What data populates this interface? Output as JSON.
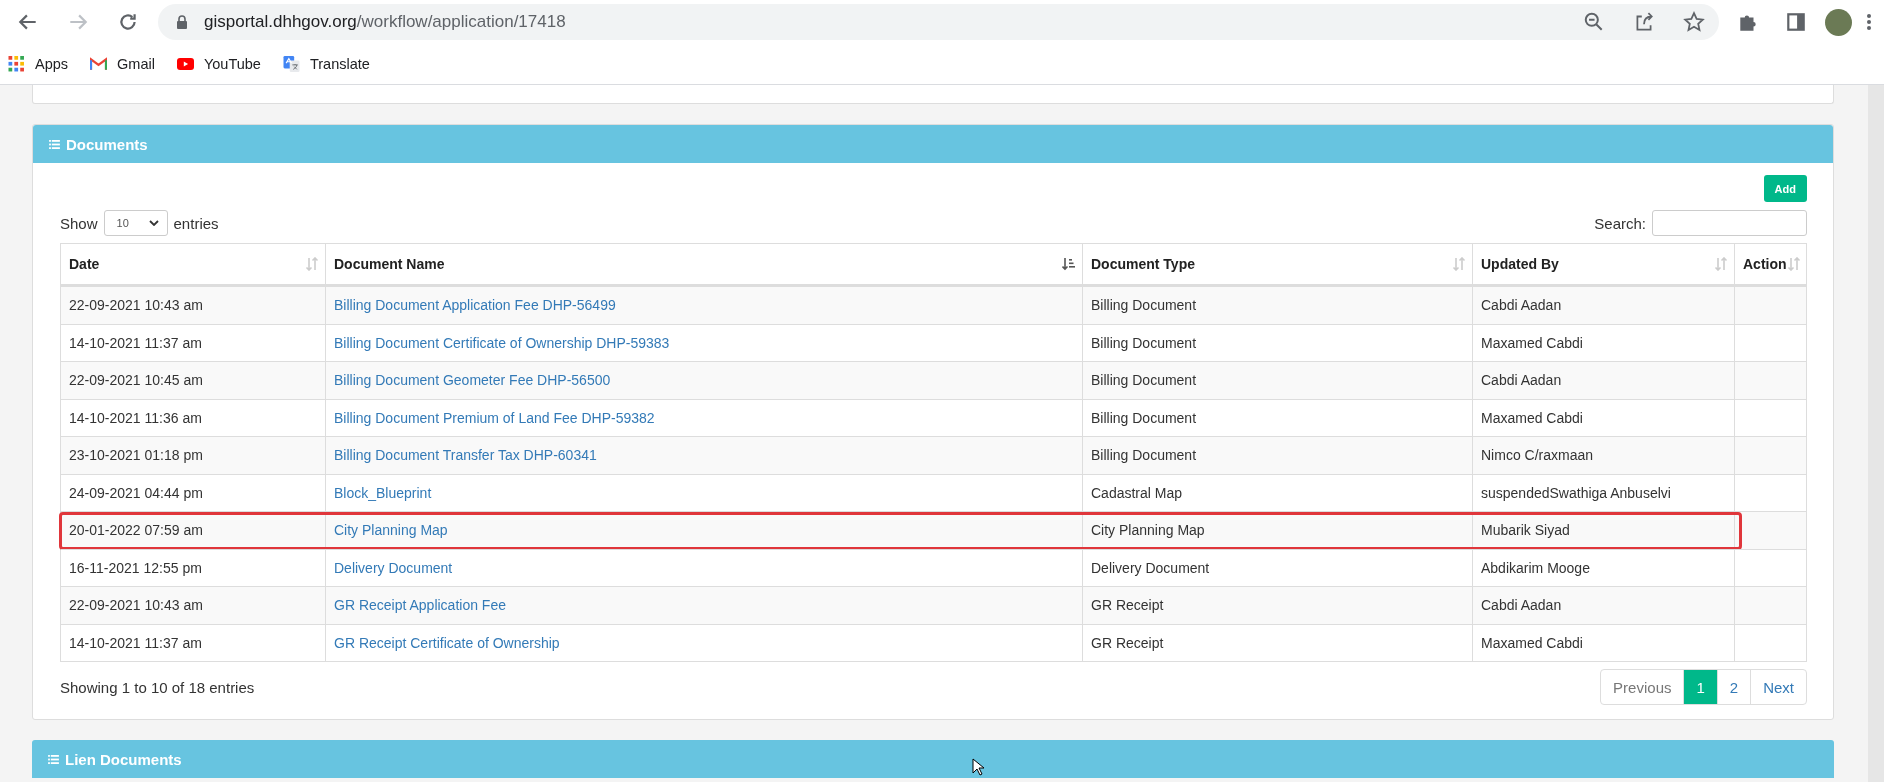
{
  "browser": {
    "url_domain": "gisportal.dhhgov.org",
    "url_path": "/workflow/application/17418",
    "bookmarks": [
      {
        "label": "Apps",
        "kind": "apps"
      },
      {
        "label": "Gmail",
        "kind": "gmail"
      },
      {
        "label": "YouTube",
        "kind": "youtube"
      },
      {
        "label": "Translate",
        "kind": "translate"
      }
    ]
  },
  "documents_panel": {
    "title": "Documents",
    "add_button": "Add",
    "show_label": "Show",
    "page_size": "10",
    "entries_label": "entries",
    "search_label": "Search:",
    "columns": [
      {
        "label": "Date",
        "sorted": false
      },
      {
        "label": "Document Name",
        "sorted": true
      },
      {
        "label": "Document Type",
        "sorted": false
      },
      {
        "label": "Updated By",
        "sorted": false
      },
      {
        "label": "Action",
        "sorted": false
      }
    ],
    "rows": [
      {
        "date": "22-09-2021 10:43 am",
        "name": "Billing Document Application Fee DHP-56499",
        "type": "Billing Document",
        "updated_by": "Cabdi Aadan",
        "highlighted": false
      },
      {
        "date": "14-10-2021 11:37 am",
        "name": "Billing Document Certificate of Ownership DHP-59383",
        "type": "Billing Document",
        "updated_by": "Maxamed Cabdi",
        "highlighted": false
      },
      {
        "date": "22-09-2021 10:45 am",
        "name": "Billing Document Geometer Fee DHP-56500",
        "type": "Billing Document",
        "updated_by": "Cabdi Aadan",
        "highlighted": false
      },
      {
        "date": "14-10-2021 11:36 am",
        "name": "Billing Document Premium of Land Fee DHP-59382",
        "type": "Billing Document",
        "updated_by": "Maxamed Cabdi",
        "highlighted": false
      },
      {
        "date": "23-10-2021 01:18 pm",
        "name": "Billing Document Transfer Tax DHP-60341",
        "type": "Billing Document",
        "updated_by": "Nimco C/raxmaan",
        "highlighted": false
      },
      {
        "date": "24-09-2021 04:44 pm",
        "name": "Block_Blueprint",
        "type": "Cadastral Map",
        "updated_by": "suspendedSwathiga Anbuselvi",
        "highlighted": false
      },
      {
        "date": "20-01-2022 07:59 am",
        "name": "City Planning Map",
        "type": "City Planning Map",
        "updated_by": "Mubarik Siyad",
        "highlighted": true
      },
      {
        "date": "16-11-2021 12:55 pm",
        "name": "Delivery Document",
        "type": "Delivery Document",
        "updated_by": "Abdikarim Mooge",
        "highlighted": false
      },
      {
        "date": "22-09-2021 10:43 am",
        "name": "GR Receipt Application Fee",
        "type": "GR Receipt",
        "updated_by": "Cabdi Aadan",
        "highlighted": false
      },
      {
        "date": "14-10-2021 11:37 am",
        "name": "GR Receipt Certificate of Ownership",
        "type": "GR Receipt",
        "updated_by": "Maxamed Cabdi",
        "highlighted": false
      }
    ],
    "info": "Showing 1 to 10 of 18 entries",
    "pagination": [
      {
        "label": "Previous",
        "kind": "prev",
        "selected": false
      },
      {
        "label": "1",
        "kind": "page",
        "selected": true
      },
      {
        "label": "2",
        "kind": "page",
        "selected": false
      },
      {
        "label": "Next",
        "kind": "next",
        "selected": false
      }
    ]
  },
  "lien_panel": {
    "title": "Lien Documents"
  }
}
